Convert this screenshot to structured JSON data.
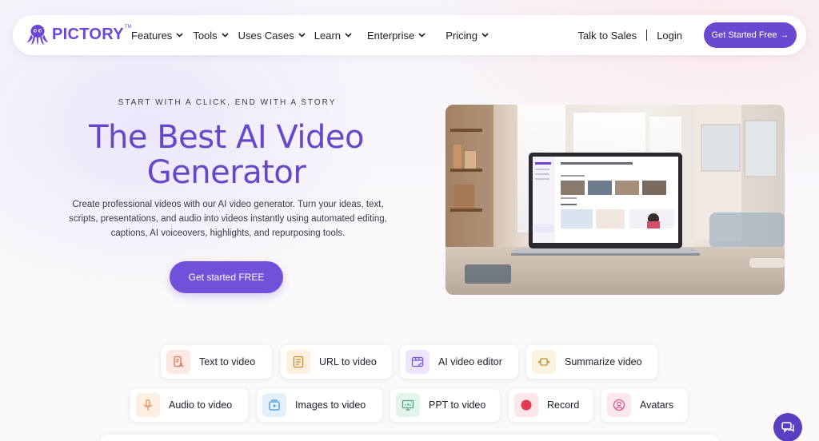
{
  "brand": {
    "name": "PICTORY",
    "tm": "TM",
    "color": "#6c46d9"
  },
  "nav": {
    "items": [
      {
        "label": "Features"
      },
      {
        "label": "Tools"
      },
      {
        "label": "Uses Cases"
      },
      {
        "label": "Learn"
      },
      {
        "label": "Enterprise"
      },
      {
        "label": "Pricing"
      }
    ],
    "talk_to_sales": "Talk to Sales",
    "login": "Login",
    "cta_label": "Get Started Free",
    "cta_arrow": "→"
  },
  "hero": {
    "eyebrow": "START WITH A CLICK, END WITH A STORY",
    "title": "The Best AI Video Generator",
    "description": "Create professional videos with our AI video generator. Turn your ideas, text, scripts, presentations, and audio into videos instantly using automated editing, captions, AI voiceovers, highlights, and repurposing tools.",
    "cta_label": "Get started FREE",
    "accent": "#6548c9"
  },
  "features": [
    {
      "label": "Text to video",
      "icon": "text-to-video-icon",
      "bg": "#fde8e4",
      "fg": "#e4735b"
    },
    {
      "label": "URL to video",
      "icon": "url-to-video-icon",
      "bg": "#fdf0df",
      "fg": "#c98a3a"
    },
    {
      "label": "AI video editor",
      "icon": "ai-video-editor-icon",
      "bg": "#ece5fb",
      "fg": "#7a5ad6"
    },
    {
      "label": "Summarize video",
      "icon": "summarize-video-icon",
      "bg": "#fbf3df",
      "fg": "#b9953f"
    },
    {
      "label": "Audio to video",
      "icon": "microphone-icon",
      "bg": "#fdeee2",
      "fg": "#e0935a"
    },
    {
      "label": "Images to video",
      "icon": "images-to-video-icon",
      "bg": "#e2f0fb",
      "fg": "#4a97cf"
    },
    {
      "label": "PPT to video",
      "icon": "ppt-to-video-icon",
      "bg": "#e3f4ea",
      "fg": "#4fa677"
    },
    {
      "label": "Record",
      "icon": "record-icon",
      "bg": "#fde6e8",
      "fg": "#e23a50"
    },
    {
      "label": "Avatars",
      "icon": "avatar-icon",
      "bg": "#fbe6ee",
      "fg": "#d05a86"
    }
  ],
  "chat_icon": "chat-icon"
}
